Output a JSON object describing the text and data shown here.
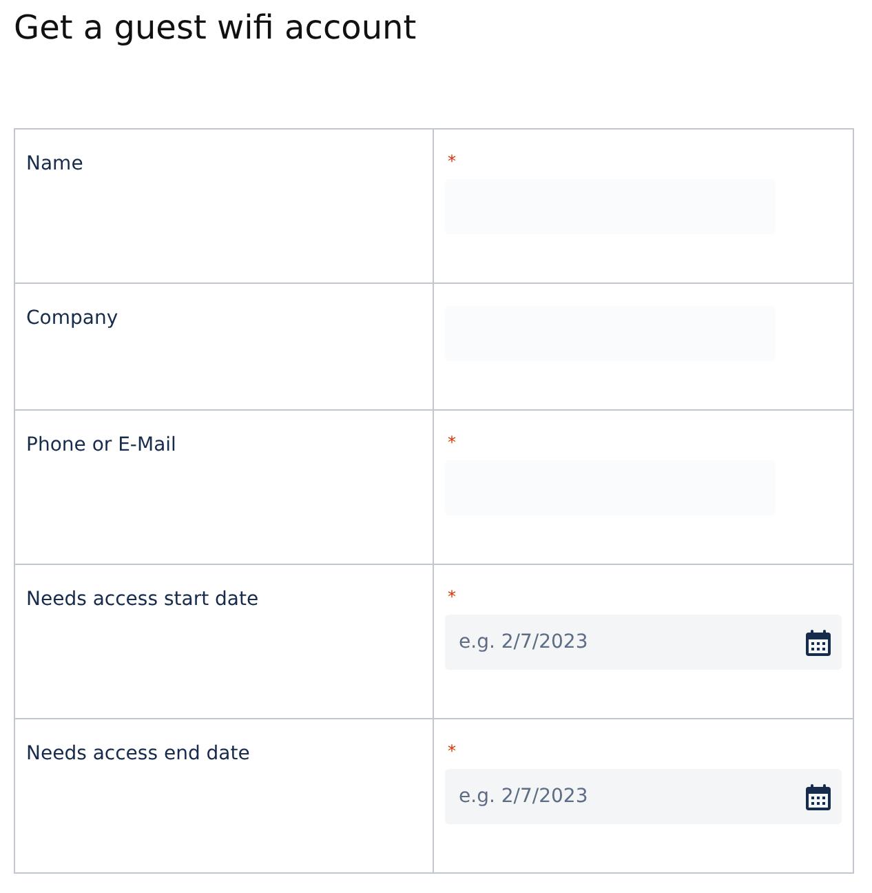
{
  "title": "Get a guest wifi account",
  "rows": [
    {
      "label": "Name",
      "required_mark": "*",
      "field": {
        "kind": "text"
      }
    },
    {
      "label": "Company",
      "field": {
        "kind": "text"
      }
    },
    {
      "label": "Phone or E-Mail",
      "required_mark": "*",
      "field": {
        "kind": "text"
      }
    },
    {
      "label": "Needs access start date",
      "required_mark": "*",
      "field": {
        "kind": "date",
        "placeholder": "e.g. 2/7/2023"
      }
    },
    {
      "label": "Needs access end date",
      "required_mark": "*",
      "field": {
        "kind": "date",
        "placeholder": "e.g. 2/7/2023"
      }
    }
  ]
}
